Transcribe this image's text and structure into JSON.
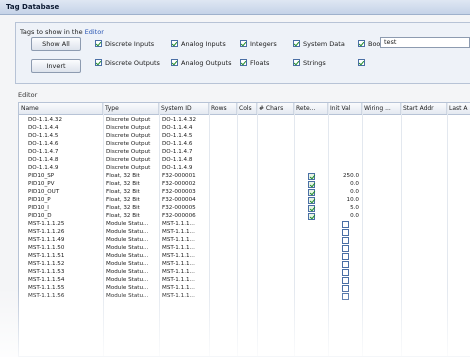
{
  "window": {
    "title": "Tag Database"
  },
  "filters": {
    "label_prefix": "Tags to show in the ",
    "label_link": "Editor",
    "show_all_label": "Show All",
    "invert_label": "Invert",
    "checkboxes": [
      {
        "label": "Discrete Inputs",
        "checked": true
      },
      {
        "label": "Analog Inputs",
        "checked": true
      },
      {
        "label": "Integers",
        "checked": true
      },
      {
        "label": "System Data",
        "checked": true
      },
      {
        "label": "Booleans",
        "checked": true
      },
      {
        "label": "Discrete Outputs",
        "checked": true
      },
      {
        "label": "Analog Outputs",
        "checked": true
      },
      {
        "label": "Floats",
        "checked": true
      },
      {
        "label": "Strings",
        "checked": true
      },
      {
        "label": "",
        "checked": true
      }
    ],
    "search_value": "test"
  },
  "editor": {
    "label": "Editor",
    "columns": [
      "Name",
      "Type",
      "System ID",
      "Rows",
      "Cols",
      "# Chars",
      "Rete...",
      "Init Val",
      "Wiring ...",
      "Start Addr",
      "Last A"
    ],
    "rows": [
      {
        "name": "DO-1.1.4.32",
        "type": "Discrete Output",
        "sysid": "DO-1.1.4.32",
        "retentive": null,
        "init": ""
      },
      {
        "name": "DO-1.1.4.4",
        "type": "Discrete Output",
        "sysid": "DO-1.1.4.4",
        "retentive": null,
        "init": ""
      },
      {
        "name": "DO-1.1.4.5",
        "type": "Discrete Output",
        "sysid": "DO-1.1.4.5",
        "retentive": null,
        "init": ""
      },
      {
        "name": "DO-1.1.4.6",
        "type": "Discrete Output",
        "sysid": "DO-1.1.4.6",
        "retentive": null,
        "init": ""
      },
      {
        "name": "DO-1.1.4.7",
        "type": "Discrete Output",
        "sysid": "DO-1.1.4.7",
        "retentive": null,
        "init": ""
      },
      {
        "name": "DO-1.1.4.8",
        "type": "Discrete Output",
        "sysid": "DO-1.1.4.8",
        "retentive": null,
        "init": ""
      },
      {
        "name": "DO-1.1.4.9",
        "type": "Discrete Output",
        "sysid": "DO-1.1.4.9",
        "retentive": null,
        "init": ""
      },
      {
        "name": "PID10_SP",
        "type": "Float, 32 Bit",
        "sysid": "F32-000001",
        "retentive": true,
        "init": "250.0"
      },
      {
        "name": "PID10_PV",
        "type": "Float, 32 Bit",
        "sysid": "F32-000002",
        "retentive": true,
        "init": "0.0"
      },
      {
        "name": "PID10_OUT",
        "type": "Float, 32 Bit",
        "sysid": "F32-000003",
        "retentive": true,
        "init": "0.0"
      },
      {
        "name": "PID10_P",
        "type": "Float, 32 Bit",
        "sysid": "F32-000004",
        "retentive": true,
        "init": "10.0"
      },
      {
        "name": "PID10_I",
        "type": "Float, 32 Bit",
        "sysid": "F32-000005",
        "retentive": true,
        "init": "5.0"
      },
      {
        "name": "PID10_D",
        "type": "Float, 32 Bit",
        "sysid": "F32-000006",
        "retentive": true,
        "init": "0.0"
      },
      {
        "name": "MST-1.1.1.25",
        "type": "Module Statu...",
        "sysid": "MST-1.1.1...",
        "retentive": null,
        "init_box": true
      },
      {
        "name": "MST-1.1.1.26",
        "type": "Module Statu...",
        "sysid": "MST-1.1.1...",
        "retentive": null,
        "init_box": true
      },
      {
        "name": "MST-1.1.1.49",
        "type": "Module Statu...",
        "sysid": "MST-1.1.1...",
        "retentive": null,
        "init_box": true
      },
      {
        "name": "MST-1.1.1.50",
        "type": "Module Statu...",
        "sysid": "MST-1.1.1...",
        "retentive": null,
        "init_box": true
      },
      {
        "name": "MST-1.1.1.51",
        "type": "Module Statu...",
        "sysid": "MST-1.1.1...",
        "retentive": null,
        "init_box": true
      },
      {
        "name": "MST-1.1.1.52",
        "type": "Module Statu...",
        "sysid": "MST-1.1.1...",
        "retentive": null,
        "init_box": true
      },
      {
        "name": "MST-1.1.1.53",
        "type": "Module Statu...",
        "sysid": "MST-1.1.1...",
        "retentive": null,
        "init_box": true
      },
      {
        "name": "MST-1.1.1.54",
        "type": "Module Statu...",
        "sysid": "MST-1.1.1...",
        "retentive": null,
        "init_box": true
      },
      {
        "name": "MST-1.1.1.55",
        "type": "Module Statu...",
        "sysid": "MST-1.1.1...",
        "retentive": null,
        "init_box": true
      },
      {
        "name": "MST-1.1.1.56",
        "type": "Module Statu...",
        "sysid": "MST-1.1.1...",
        "retentive": null,
        "init_box": true
      }
    ]
  }
}
